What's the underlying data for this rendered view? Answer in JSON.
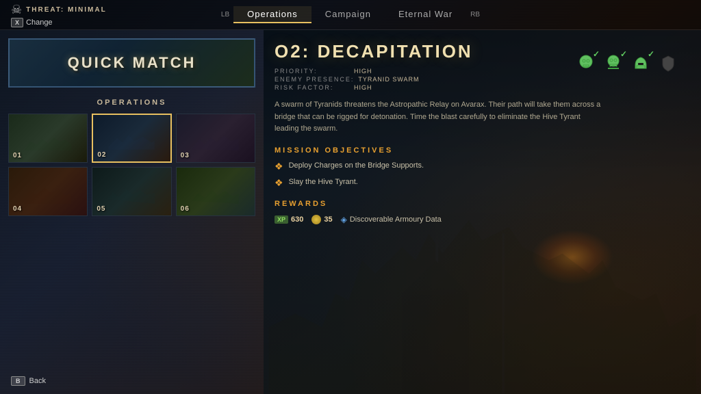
{
  "threat": {
    "label": "THREAT: MINIMAL",
    "change_btn": "X",
    "change_label": "Change"
  },
  "nav": {
    "lb_indicator": "LB",
    "rb_indicator": "RB",
    "tabs": [
      {
        "id": "operations",
        "label": "Operations",
        "active": true
      },
      {
        "id": "campaign",
        "label": "Campaign",
        "active": false
      },
      {
        "id": "eternal_war",
        "label": "Eternal War",
        "active": false
      }
    ]
  },
  "left_panel": {
    "quick_match_label": "QUICK MATCH",
    "operations_heading": "OPERATIONS",
    "missions": [
      {
        "id": "01",
        "label": "01",
        "selected": false
      },
      {
        "id": "02",
        "label": "02",
        "selected": true
      },
      {
        "id": "03",
        "label": "03",
        "selected": false
      },
      {
        "id": "04",
        "label": "04",
        "selected": false
      },
      {
        "id": "05",
        "label": "05",
        "selected": false
      },
      {
        "id": "06",
        "label": "06",
        "selected": false
      }
    ]
  },
  "mission_detail": {
    "title": "O2: DECAPITATION",
    "meta": {
      "priority_key": "PRIORITY:",
      "priority_value": "HIGH",
      "enemy_key": "ENEMY PRESENCE:",
      "enemy_value": "TYRANID SWARM",
      "risk_key": "RISK FACTOR:",
      "risk_value": "HIGH"
    },
    "description": "A swarm of Tyranids threatens the Astropathic Relay on Avarax. Their path will take them across a bridge that can be rigged for detonation. Time the blast carefully to eliminate the Hive Tyrant leading the swarm.",
    "objectives_heading": "MISSION OBJECTIVES",
    "objectives": [
      {
        "id": "obj1",
        "text": "Deploy Charges on the Bridge Supports."
      },
      {
        "id": "obj2",
        "text": "Slay the Hive Tyrant."
      }
    ],
    "rewards_heading": "REWARDS",
    "rewards": [
      {
        "id": "xp",
        "icon": "XP",
        "value": "630"
      },
      {
        "id": "coins",
        "value": "35"
      },
      {
        "id": "data",
        "label": "Discoverable Armoury Data"
      }
    ],
    "difficulty_icons": [
      {
        "id": "icon1",
        "type": "skull",
        "active": true
      },
      {
        "id": "icon2",
        "type": "crossbones",
        "active": true
      },
      {
        "id": "icon3",
        "type": "helmet",
        "active": true
      },
      {
        "id": "icon4",
        "type": "shield",
        "active": false
      }
    ]
  },
  "bottom": {
    "back_btn": "B",
    "back_label": "Back"
  }
}
